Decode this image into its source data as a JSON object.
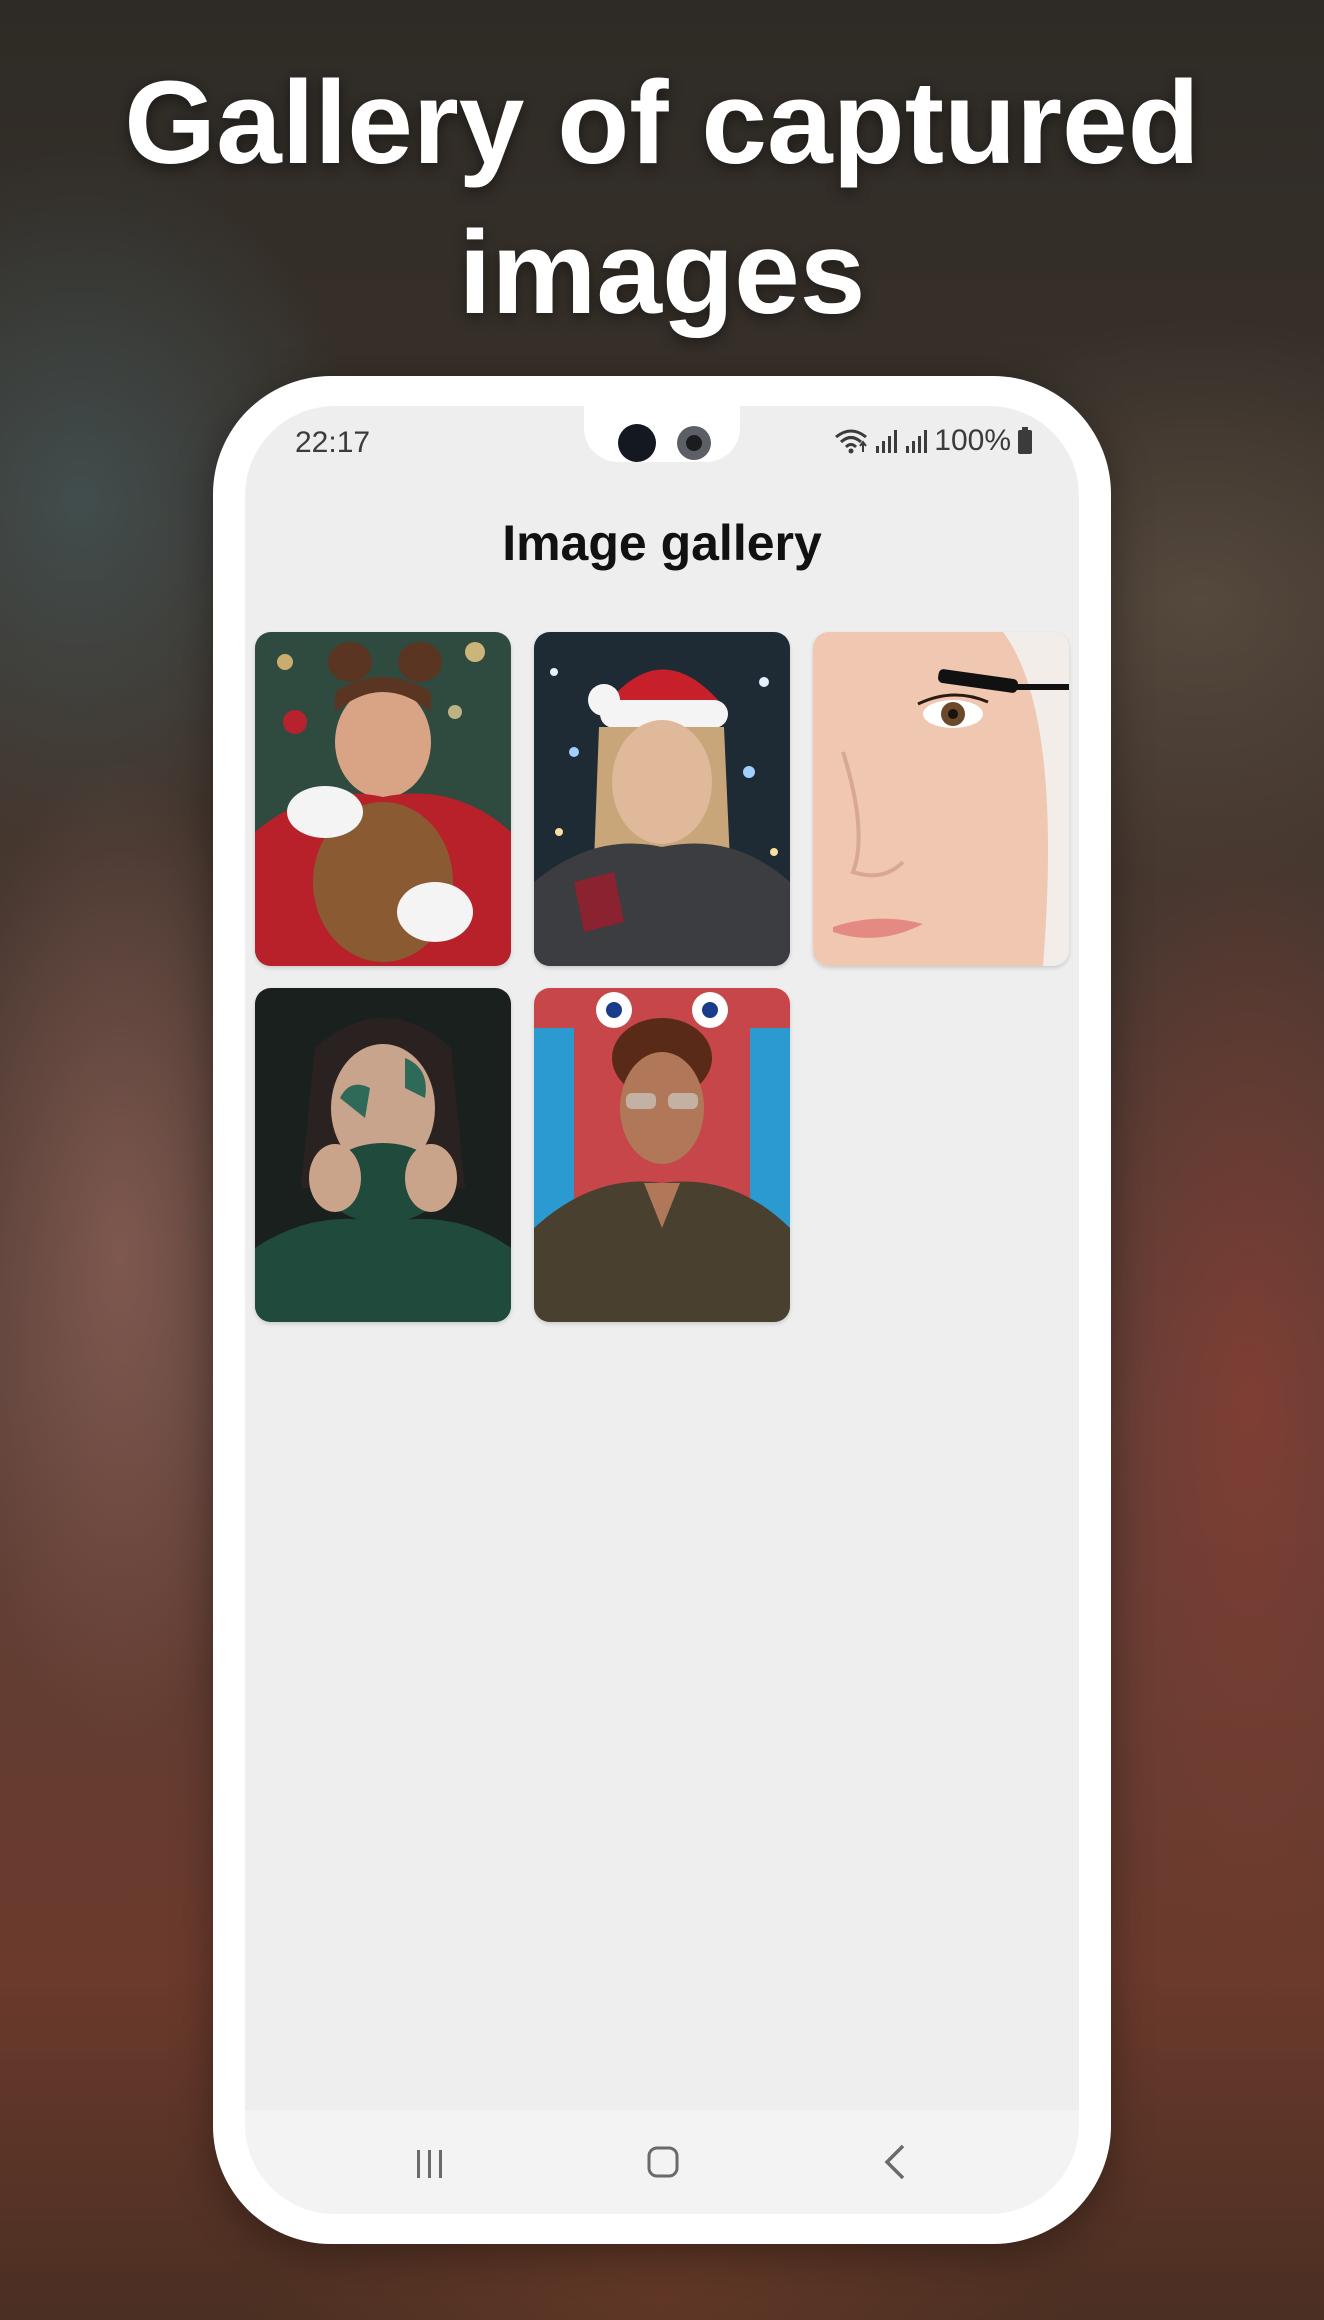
{
  "headline": {
    "line1": "Gallery of captured",
    "line2": "images"
  },
  "status_bar": {
    "time": "22:17",
    "battery": "100%",
    "icons": [
      "wifi-icon",
      "signal-icon",
      "signal-icon",
      "battery-icon"
    ]
  },
  "screen": {
    "title": "Image gallery"
  },
  "gallery": {
    "images": [
      {
        "subject": "woman in red sweater hugging teddy bear"
      },
      {
        "subject": "woman in santa hat with bokeh lights"
      },
      {
        "subject": "close-up face with mascara brush"
      },
      {
        "subject": "woman in green sweater with face paint"
      },
      {
        "subject": "man with sunglasses in neon setting"
      }
    ]
  },
  "nav_bar": {
    "icons": [
      "recents-icon",
      "home-icon",
      "back-icon"
    ]
  }
}
